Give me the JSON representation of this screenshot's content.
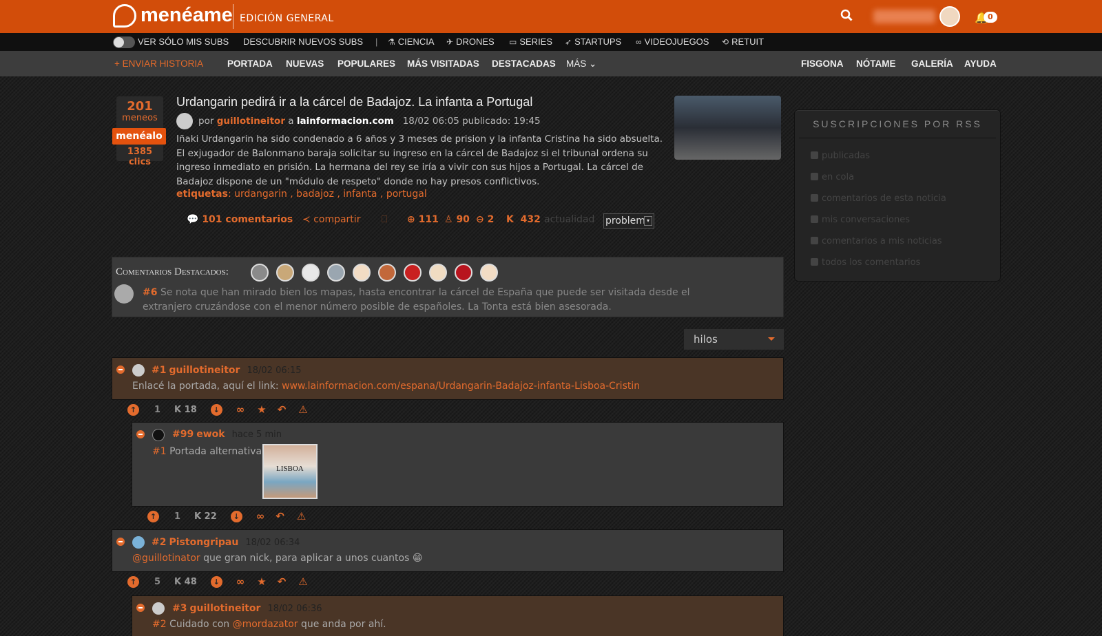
{
  "header": {
    "logo_text": "menéame",
    "edition": "EDICIÓN GENERAL",
    "notifications": "0"
  },
  "subs_bar": {
    "toggle_label": "VER SÓLO MIS SUBS",
    "discover": "DESCUBRIR NUEVOS SUBS",
    "separator": "|",
    "subs": [
      {
        "label": "CIENCIA",
        "icon": "flask-icon"
      },
      {
        "label": "DRONES",
        "icon": "drone-icon"
      },
      {
        "label": "SERIES",
        "icon": "monitor-icon"
      },
      {
        "label": "STARTUPS",
        "icon": "rocket-icon"
      },
      {
        "label": "VIDEOJUEGOS",
        "icon": "gamepad-icon"
      },
      {
        "label": "RETUIT",
        "icon": "retweet-icon"
      }
    ]
  },
  "nav": {
    "send_story": "+ ENVIAR HISTORIA",
    "items": [
      "PORTADA",
      "NUEVAS",
      "POPULARES",
      "MÁS VISITADAS",
      "DESTACADAS",
      "MÁS ⌄"
    ],
    "right_items": [
      "FISGONA",
      "NÓTAME",
      "GALERÍA",
      "AYUDA"
    ]
  },
  "story": {
    "votes": "201",
    "votes_label": "meneos",
    "menealo": "menéalo",
    "clicks": "1385 clics",
    "title": "Urdangarin pedirá ir a la cárcel de Badajoz. La infanta a Portugal",
    "by": "por",
    "author": "guillotineitor",
    "a": "a",
    "domain": "lainformacion.com",
    "dates": "18/02 06:05 publicado: 19:45",
    "body": "Iñaki Urdangarin ha sido condenado a 6 años y 3 meses de prision y la infanta Cristina ha sido absuelta. El exjugador de Balonmano baraja solicitar su ingreso en la cárcel de Badajoz si el tribunal ordena su ingreso inmediato en prisión. La hermana del rey se iría a vivir con sus hijos a Portugal. La cárcel de Badajoz dispone de un \"módulo de respeto\" donde no hay presos conflictivos.",
    "tags_label": "etiquetas",
    "tags": ": urdangarin , badajoz , infanta , portugal",
    "comments": "101 comentarios",
    "share": "compartir",
    "up": "111",
    "anon": "90",
    "down": "2",
    "karma_k": "K",
    "karma": "432",
    "sub": "actualidad",
    "problem": "problem"
  },
  "sidebar": {
    "title": "SUSCRIPCIONES POR RSS",
    "items": [
      "publicadas",
      "en cola",
      "comentarios de esta noticia",
      "mis conversaciones",
      "comentarios a mis noticias",
      "todos los comentarios"
    ]
  },
  "featured": {
    "label": "Comentarios Destacados:",
    "num": "#6",
    "text": "Se nota que han mirado bien los mapas, hasta encontrar la cárcel de España que puede ser visitada desde el extranjero cruzándose con el menor número posible de españoles. La Tonta está bien asesorada."
  },
  "sort": {
    "value": "hilos"
  },
  "comments": [
    {
      "num": "#1",
      "user": "guillotineitor",
      "date": "18/02 06:15",
      "prefix": "Enlacé la portada, aquí el link: ",
      "link": "www.lainformacion.com/espana/Urdangarin-Badajoz-infanta-Lisboa-Cristin",
      "votes": "1",
      "karma": "K 18"
    },
    {
      "num": "#99",
      "user": "ewok",
      "date": "hace 5 min",
      "ref": "#1",
      "text": " Portada alternativa:",
      "image_text": "LISBOA",
      "votes": "1",
      "karma": "K 22"
    },
    {
      "num": "#2",
      "user": "Pistongripau",
      "date": "18/02 06:34",
      "mention": "@guillotinator",
      "text": " que gran nick, para aplicar a unos cuantos ",
      "emoji": "😁",
      "votes": "5",
      "karma": "K 48"
    },
    {
      "num": "#3",
      "user": "guillotineitor",
      "date": "18/02 06:36",
      "ref": "#2",
      "pre": " Cuidado con ",
      "mention": "@mordazator",
      "text": " que anda por ahí."
    }
  ],
  "colors": {
    "brand": "#d24d0a",
    "accent": "#e36b2d",
    "nav_bg": "#3d3d3d"
  }
}
